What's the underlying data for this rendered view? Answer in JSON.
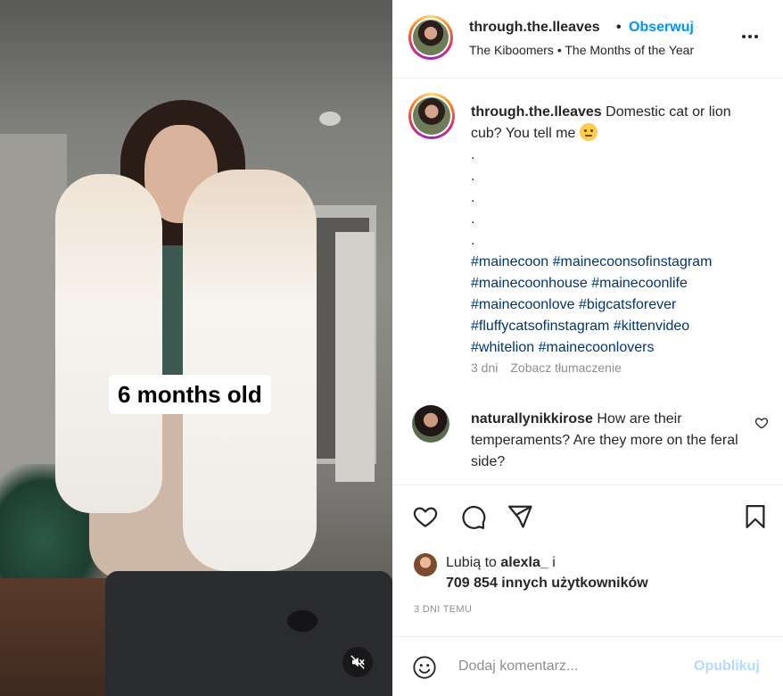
{
  "media": {
    "video_caption": "6 months old",
    "mute_icon": "speaker-muted-icon"
  },
  "header": {
    "username": "through.the.lleaves",
    "separator": "•",
    "follow_label": "Obserwuj",
    "audio": "The Kiboomers • The Months of the Year",
    "more_icon": "more-options-icon"
  },
  "caption": {
    "username": "through.the.lleaves",
    "text": "Domestic cat or lion cub? You tell me",
    "emoji": "slightly-frowning-face",
    "dots": [
      ".",
      ".",
      ".",
      ".",
      "."
    ],
    "hashtags": [
      "#mainecoon",
      "#mainecoonsofinstagram",
      "#mainecoonhouse",
      "#mainecoonlife",
      "#mainecoonlove",
      "#bigcatsforever",
      "#fluffycatsofinstagram",
      "#kittenvideo",
      "#whitelion",
      "#mainecoonlovers"
    ],
    "age": "3 dni",
    "translate_label": "Zobacz tłumaczenie"
  },
  "comment": {
    "username": "naturallynikkirose",
    "text": "How are their temperaments? Are they more on the feral side?"
  },
  "actions": {
    "liked_prefix": "Lubią to",
    "liked_user": "alexla_",
    "liked_and": "i",
    "likes_count": "709 854 innych użytkowników",
    "post_age": "3 DNI TEMU"
  },
  "composer": {
    "placeholder": "Dodaj komentarz...",
    "publish_label": "Opublikuj"
  },
  "colors": {
    "accent": "#0095f6",
    "publish_disabled": "#b3dbff",
    "hashtag": "#00376b",
    "muted_text": "#8e8e8e"
  }
}
